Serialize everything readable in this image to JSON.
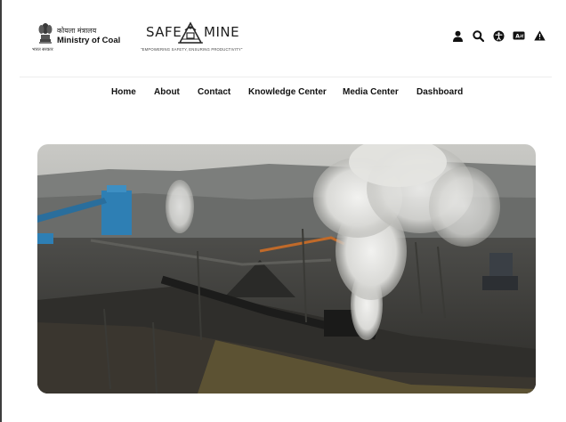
{
  "header": {
    "ministry_hindi": "कोयला मंत्रालय",
    "ministry_name": "Ministry of Coal",
    "emblem_caption": "भारत सरकार",
    "logo_word_left": "SAFE",
    "logo_word_right": "MINE",
    "logo_tagline": "\"EMPOWERING SAFETY, ENSURING PRODUCTIVITY\""
  },
  "tools": [
    {
      "name": "user-icon"
    },
    {
      "name": "search-icon"
    },
    {
      "name": "accessibility-icon"
    },
    {
      "name": "translate-icon"
    },
    {
      "name": "alert-icon"
    }
  ],
  "nav": {
    "items": [
      "Home",
      "About",
      "Contact",
      "Knowledge Center",
      "Media Center",
      "Dashboard"
    ]
  },
  "colors": {
    "text": "#111111",
    "divider": "#ededed"
  }
}
